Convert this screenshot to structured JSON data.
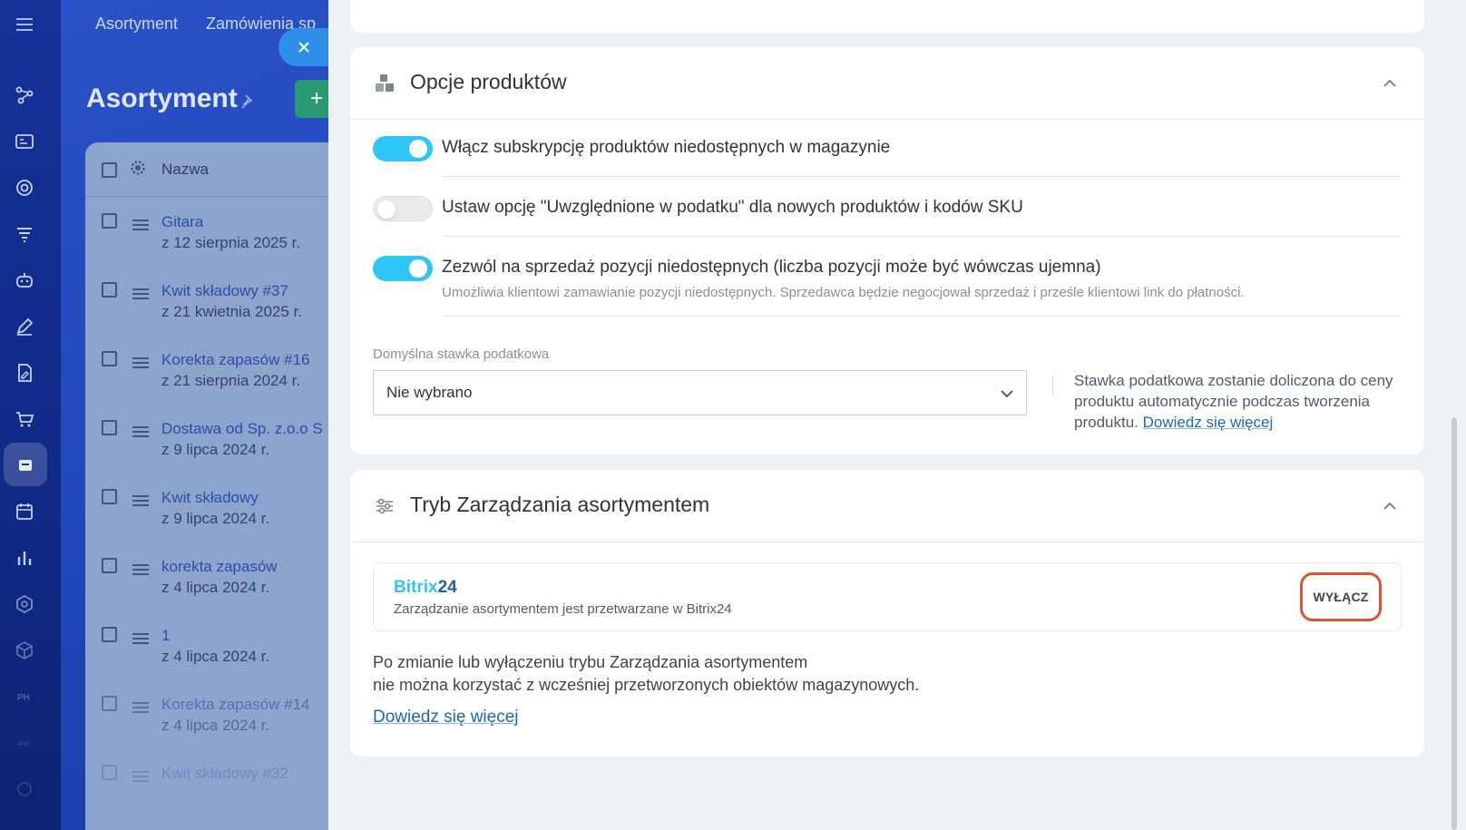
{
  "background": {
    "tabs": [
      "Asortyment",
      "Zamówienia sp"
    ],
    "title": "Asortyment",
    "add_button": "+",
    "table": {
      "header": "Nazwa",
      "rows": [
        {
          "name": "Gitara",
          "date": "z 12 sierpnia 2025 r."
        },
        {
          "name": "Kwit składowy #37",
          "date": "z 21 kwietnia 2025 r."
        },
        {
          "name": "Korekta zapasów #16",
          "date": "z 21 sierpnia 2024 r."
        },
        {
          "name": "Dostawa od Sp. z.o.o S",
          "date": "z 9 lipca 2024 r."
        },
        {
          "name": "Kwit składowy",
          "date": "z 9 lipca 2024 r."
        },
        {
          "name": "korekta zapasów",
          "date": "z 4 lipca 2024 r."
        },
        {
          "name": "1",
          "date": "z 4 lipca 2024 r."
        },
        {
          "name": "Korekta zapasów #14",
          "date": "z 4 lipca 2024 r."
        },
        {
          "name": "Kwit składowy #32",
          "date": ""
        }
      ]
    }
  },
  "product_options": {
    "title": "Opcje produktów",
    "options": [
      {
        "label": "Włącz subskrypcję produktów niedostępnych w magazynie",
        "enabled": true,
        "description": ""
      },
      {
        "label": "Ustaw opcję \"Uwzględnione w podatku\" dla nowych produktów i kodów SKU",
        "enabled": false,
        "description": ""
      },
      {
        "label": "Zezwól na sprzedaż pozycji niedostępnych (liczba pozycji może być wówczas ujemna)",
        "enabled": true,
        "description": "Umożliwia klientowi zamawianie pozycji niedostępnych. Sprzedawca będzie negocjował sprzedaż i prześle klientowi link do płatności."
      }
    ],
    "tax": {
      "label": "Domyślna stawka podatkowa",
      "selected": "Nie wybrano",
      "hint": "Stawka podatkowa zostanie doliczona do ceny produktu automatycznie podczas tworzenia produktu.",
      "hint_link": "Dowiedz się więcej"
    }
  },
  "inventory_mode": {
    "title": "Tryb Zarządzania asortymentem",
    "provider_logo_part1": "Bitrix",
    "provider_logo_part2": "24",
    "provider_description": "Zarządzanie asortymentem jest przetwarzane w Bitrix24",
    "disable_button": "WYŁĄCZ",
    "note_line1": "Po zmianie lub wyłączeniu trybu Zarządzania asortymentem",
    "note_line2": "nie można korzystać z wcześniej przetworzonych obiektów magazynowych.",
    "learn_more": "Dowiedz się więcej"
  },
  "colors": {
    "toggle_on": "#2fc6f6",
    "link": "#2067b0",
    "highlight": "#e0522f"
  }
}
